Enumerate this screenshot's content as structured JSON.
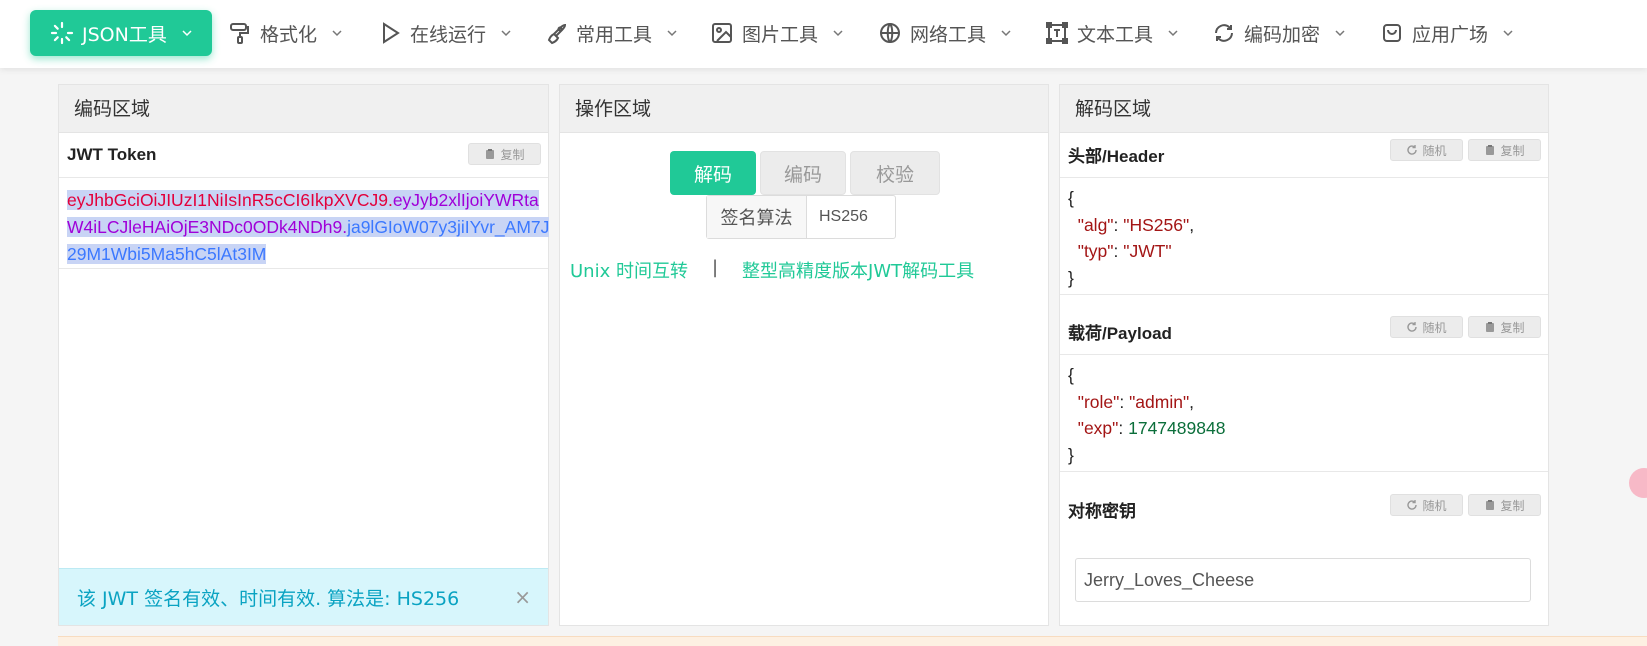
{
  "nav": {
    "items": [
      {
        "label": "JSON工具"
      },
      {
        "label": "格式化"
      },
      {
        "label": "在线运行"
      },
      {
        "label": "常用工具"
      },
      {
        "label": "图片工具"
      },
      {
        "label": "网络工具"
      },
      {
        "label": "文本工具"
      },
      {
        "label": "编码加密"
      },
      {
        "label": "应用广场"
      }
    ]
  },
  "encode_panel": {
    "title": "编码区域",
    "token_label": "JWT Token",
    "copy_label": "复制",
    "token_header": "eyJhbGciOiJIUzI1NiIsInR5cCI6IkpXVCJ9.",
    "token_payload": "eyJyb2xlIjoiYWRtaW4iLCJleHAiOjE3NDc0ODk4NDh9.",
    "token_signature": "ja9lGIoW07y3jiIYvr_AM7J29M1Wbi5Ma5hC5lAt3IM",
    "alert_text": "该 JWT 签名有效、时间有效. 算法是: HS256",
    "alert_close": "×"
  },
  "operate_panel": {
    "title": "操作区域",
    "tabs": [
      {
        "label": "解码"
      },
      {
        "label": "编码"
      },
      {
        "label": "校验"
      }
    ],
    "algo_label": "签名算法",
    "algo_value": "HS256",
    "link_unix": "Unix 时间互转",
    "link_sep": "|",
    "link_bigint": "整型高精度版本JWT解码工具"
  },
  "decode_panel": {
    "title": "解码区域",
    "header_label": "头部/Header",
    "payload_label": "载荷/Payload",
    "secret_label": "对称密钥",
    "random_label": "随机",
    "copy_label": "复制",
    "header_json": {
      "open": "{",
      "close": "}",
      "k1": "\"alg\"",
      "v1": "\"HS256\"",
      "k2": "\"typ\"",
      "v2": "\"JWT\""
    },
    "payload_json": {
      "open": "{",
      "close": "}",
      "k1": "\"role\"",
      "v1": "\"admin\"",
      "k2": "\"exp\"",
      "v2": "1747489848"
    },
    "secret_value": "Jerry_Loves_Cheese"
  },
  "colors": {
    "accent": "#20c997",
    "alert_bg": "#d7f6fc",
    "alert_text": "#0aa3c2",
    "token_header": "#e3003b",
    "token_payload": "#a000d8",
    "token_signature": "#3b78ff",
    "json_string": "#a31515",
    "json_number": "#0b6e3a"
  }
}
